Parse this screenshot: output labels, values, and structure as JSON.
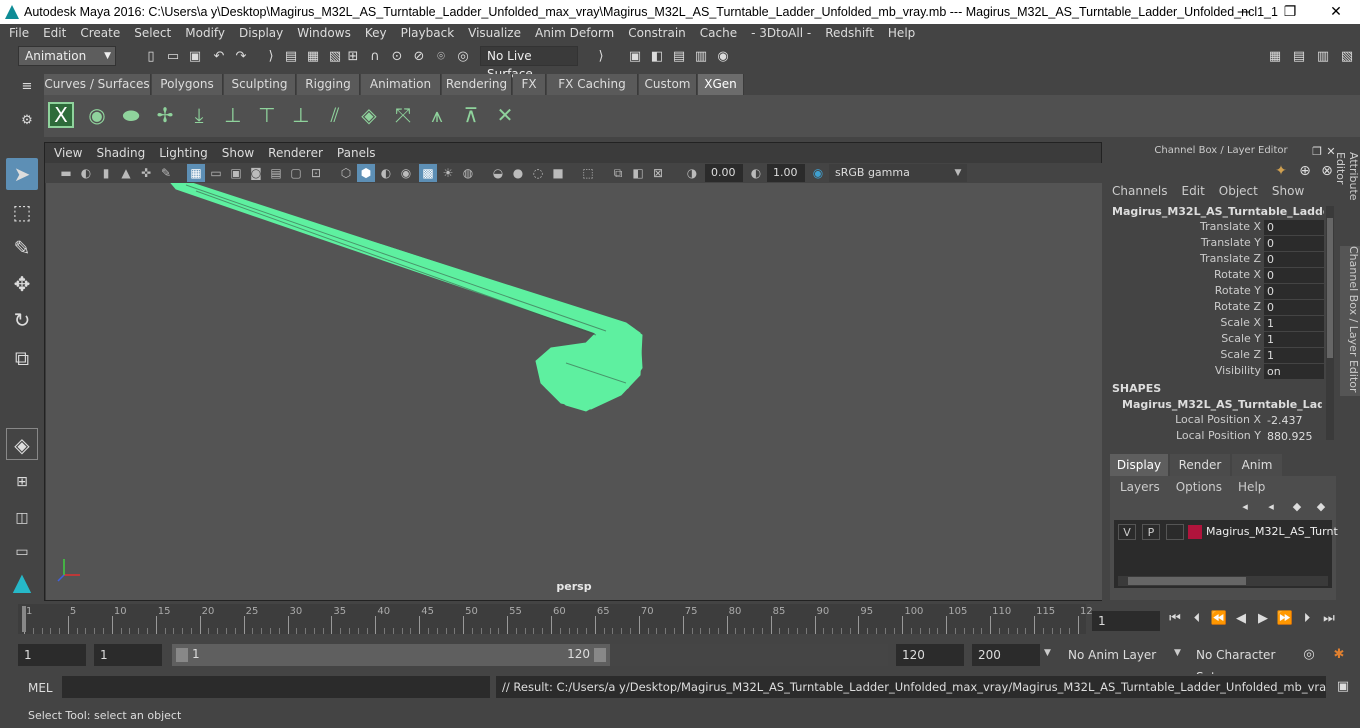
{
  "window": {
    "title": "Autodesk Maya 2016: C:\\Users\\a y\\Desktop\\Magirus_M32L_AS_Turntable_Ladder_Unfolded_max_vray\\Magirus_M32L_AS_Turntable_Ladder_Unfolded_mb_vray.mb   ---   Magirus_M32L_AS_Turntable_Ladder_Unfolded_ncl1_1",
    "minimize": "—",
    "maximize": "❐",
    "close": "✕"
  },
  "menubar": [
    "File",
    "Edit",
    "Create",
    "Select",
    "Modify",
    "Display",
    "Windows",
    "Key",
    "Playback",
    "Visualize",
    "Anim Deform",
    "Constrain",
    "Cache",
    "- 3DtoAll -",
    "Redshift",
    "Help"
  ],
  "statusline": {
    "mode": "Animation",
    "live_surface": "No Live Surface"
  },
  "shelf": {
    "tabs": [
      "Curves / Surfaces",
      "Polygons",
      "Sculpting",
      "Rigging",
      "Animation",
      "Rendering",
      "FX",
      "FX Caching",
      "Custom",
      "XGen"
    ],
    "active_tab": "XGen"
  },
  "viewport": {
    "menus": [
      "View",
      "Shading",
      "Lighting",
      "Show",
      "Renderer",
      "Panels"
    ],
    "value_a": "0.00",
    "value_b": "1.00",
    "color_space": "sRGB gamma",
    "camera_label": "persp",
    "model_color": "#5ef0a0"
  },
  "channel_box": {
    "panel_title": "Channel Box / Layer Editor",
    "menus": [
      "Channels",
      "Edit",
      "Object",
      "Show"
    ],
    "object_name": "Magirus_M32L_AS_Turntable_Ladder_...",
    "attributes": [
      {
        "label": "Translate X",
        "value": "0"
      },
      {
        "label": "Translate Y",
        "value": "0"
      },
      {
        "label": "Translate Z",
        "value": "0"
      },
      {
        "label": "Rotate X",
        "value": "0"
      },
      {
        "label": "Rotate Y",
        "value": "0"
      },
      {
        "label": "Rotate Z",
        "value": "0"
      },
      {
        "label": "Scale X",
        "value": "1"
      },
      {
        "label": "Scale Y",
        "value": "1"
      },
      {
        "label": "Scale Z",
        "value": "1"
      },
      {
        "label": "Visibility",
        "value": "on"
      }
    ],
    "shapes_header": "SHAPES",
    "shape_name": "Magirus_M32L_AS_Turntable_Ladde...",
    "shape_attributes": [
      {
        "label": "Local Position X",
        "value": "-2.437"
      },
      {
        "label": "Local Position Y",
        "value": "880.925"
      }
    ],
    "side_tabs": [
      "Attribute Editor",
      "Channel Box / Layer Editor"
    ]
  },
  "layer_editor": {
    "tabs": [
      "Display",
      "Render",
      "Anim"
    ],
    "active_tab": "Display",
    "menus": [
      "Layers",
      "Options",
      "Help"
    ],
    "layer": {
      "visible": "V",
      "playback": "P",
      "name": "Magirus_M32L_AS_Turnt",
      "color": "#b0143c"
    }
  },
  "timeline": {
    "ticks": [
      "1",
      "5",
      "10",
      "15",
      "20",
      "25",
      "30",
      "35",
      "40",
      "45",
      "50",
      "55",
      "60",
      "65",
      "70",
      "75",
      "80",
      "85",
      "90",
      "95",
      "100",
      "105",
      "110",
      "115",
      "12"
    ],
    "current_frame": "1"
  },
  "range": {
    "start": "1",
    "playback_start": "1",
    "slider_start": "1",
    "slider_end": "120",
    "playback_end": "120",
    "end": "200",
    "anim_layer": "No Anim Layer",
    "character_set": "No Character Set"
  },
  "command_line": {
    "label": "MEL",
    "result": "// Result: C:/Users/a y/Desktop/Magirus_M32L_AS_Turntable_Ladder_Unfolded_max_vray/Magirus_M32L_AS_Turntable_Ladder_Unfolded_mb_vray.mb"
  },
  "help_line": "Select Tool: select an object"
}
